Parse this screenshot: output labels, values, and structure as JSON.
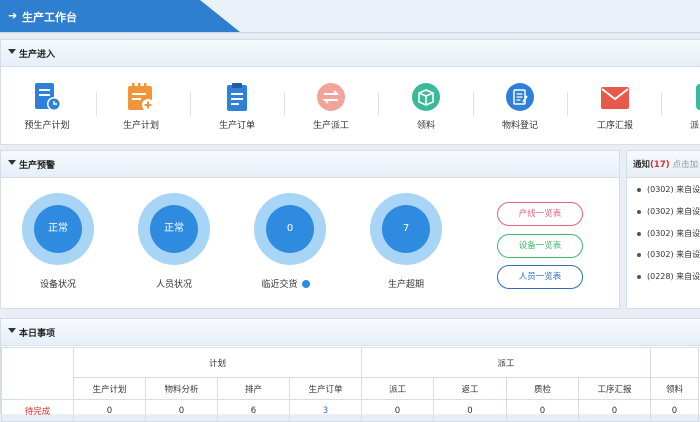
{
  "header": {
    "title": "生产工作台"
  },
  "entry_panel": {
    "title": "生产进入",
    "items": [
      {
        "label": "预生产计划",
        "icon": "doc-clock-icon",
        "color": "#2f80d8"
      },
      {
        "label": "生产计划",
        "icon": "calendar-plus-icon",
        "color": "#f0953a"
      },
      {
        "label": "生产订单",
        "icon": "clipboard-list-icon",
        "color": "#2f80d8"
      },
      {
        "label": "生产派工",
        "icon": "swap-arrows-icon",
        "color": "#f3a39a"
      },
      {
        "label": "领料",
        "icon": "box-icon",
        "color": "#3cb89b"
      },
      {
        "label": "物料登记",
        "icon": "edit-doc-icon",
        "color": "#2f80d8"
      },
      {
        "label": "工序汇报",
        "icon": "mail-icon",
        "color": "#e8594a"
      },
      {
        "label": "派",
        "icon": "partial-icon",
        "color": "#3cb89b"
      }
    ]
  },
  "warning_panel": {
    "title": "生产预警",
    "gauges": [
      {
        "value": "正常",
        "label": "设备状况"
      },
      {
        "value": "正常",
        "label": "人员状况"
      },
      {
        "value": "0",
        "label": "临近交货"
      },
      {
        "value": "7",
        "label": "生产超期"
      }
    ],
    "buttons": [
      {
        "label": "产线一览表",
        "color": "#e8607a"
      },
      {
        "label": "设备一览表",
        "color": "#3cb86a"
      },
      {
        "label": "人员一览表",
        "color": "#2f6fb8"
      }
    ]
  },
  "notice_panel": {
    "title": "通知",
    "count": "(17)",
    "hint": "点击加",
    "items": [
      {
        "text": "(0302) 来自设"
      },
      {
        "text": "(0302) 来自设"
      },
      {
        "text": "(0302) 来自设"
      },
      {
        "text": "(0302) 来自设"
      },
      {
        "text": "(0228) 来自设"
      }
    ]
  },
  "today_panel": {
    "title": "本日事项",
    "groups": {
      "plan": "计划",
      "dispatch": "派工"
    },
    "columns": [
      "生产计划",
      "物料分析",
      "排产",
      "生产订单",
      "派工",
      "返工",
      "质检",
      "工序汇报",
      "领料"
    ],
    "rows": [
      {
        "status": "待完成",
        "values": [
          "0",
          "0",
          "6",
          "3",
          "0",
          "0",
          "0",
          "0",
          "0"
        ]
      }
    ]
  }
}
